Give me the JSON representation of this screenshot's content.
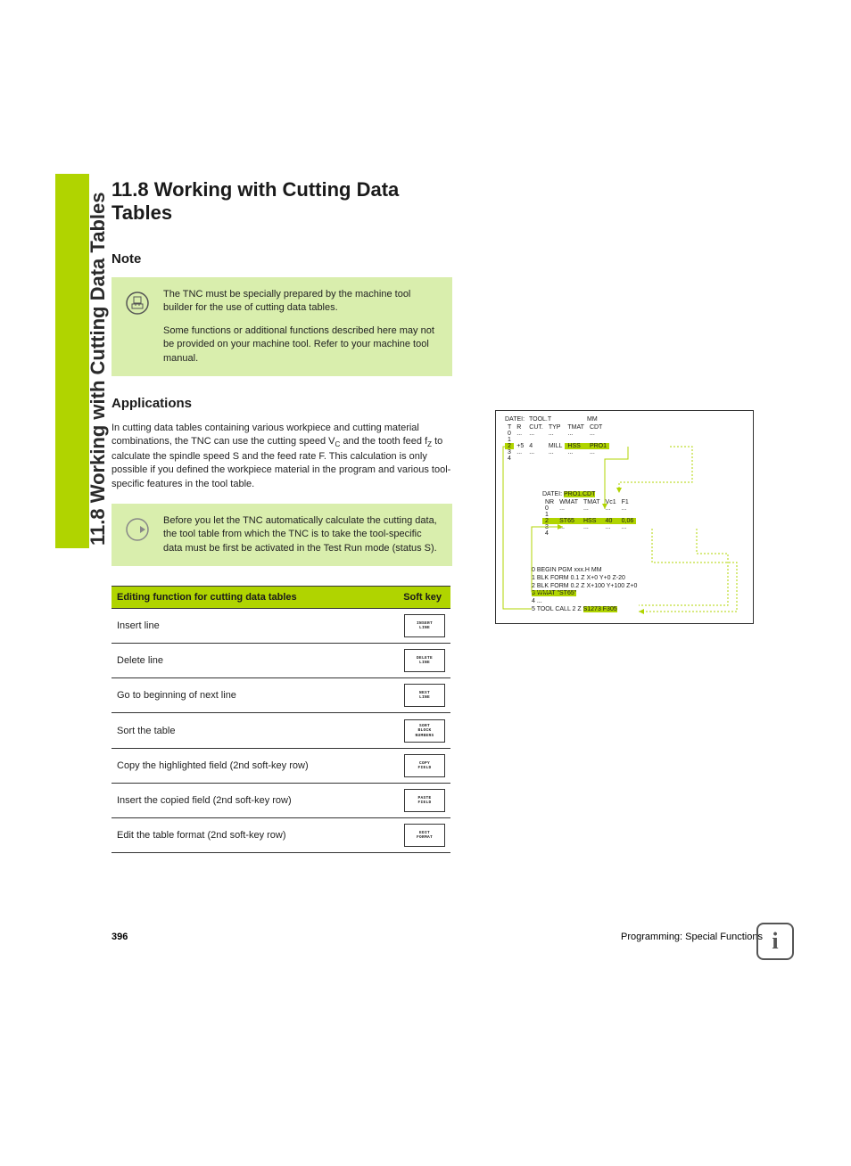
{
  "sideTab": "11.8 Working with Cutting Data Tables",
  "heading": "11.8 Working with Cutting Data Tables",
  "noteHeading": "Note",
  "note": {
    "p1": "The TNC must be specially prepared by the machine tool builder for the use of cutting data tables.",
    "p2": "Some functions or additional functions described here may not be provided on your machine tool. Refer to your machine tool manual."
  },
  "appsHeading": "Applications",
  "apps": {
    "body": "In cutting data tables containing various workpiece and cutting material combinations, the TNC can use the cutting speed V<sub>C</sub> and the tooth feed f<sub>Z</sub> to calculate the spindle speed S and the feed rate F. This calculation is only possible if you defined the workpiece material in the program and various tool-specific features in the tool table.",
    "tip": "Before you let the TNC automatically calculate the cutting data, the tool table from which the TNC is to take the tool-specific data must be first be activated in the Test Run mode (status S)."
  },
  "tableHeader": {
    "func": "Editing function for cutting data tables",
    "key": "Soft key"
  },
  "rows": [
    {
      "func": "Insert line",
      "key": [
        "INSERT",
        "LINE"
      ]
    },
    {
      "func": "Delete line",
      "key": [
        "DELETE",
        "LINE"
      ]
    },
    {
      "func": "Go to beginning of next line",
      "key": [
        "NEXT",
        "LINE"
      ]
    },
    {
      "func": "Sort the table",
      "key": [
        "SORT",
        "BLOCK",
        "NUMBERS"
      ]
    },
    {
      "func": "Copy the highlighted field (2nd soft-key row)",
      "key": [
        "COPY",
        "FIELD"
      ]
    },
    {
      "func": "Insert the copied field (2nd soft-key row)",
      "key": [
        "PASTE",
        "FIELD"
      ]
    },
    {
      "func": "Edit the table format (2nd soft-key row)",
      "key": [
        "EDIT",
        "FORMAT"
      ]
    }
  ],
  "diag": {
    "t1": {
      "title": [
        "DATEI:",
        "TOOL.T",
        "MM"
      ],
      "head": [
        "T",
        "R",
        "CUT.",
        "TYP",
        "TMAT",
        "CDT"
      ],
      "r0": [
        "0",
        "...",
        "...",
        "...",
        "...",
        "..."
      ],
      "r1": [
        "1",
        " ",
        " ",
        " ",
        " ",
        " "
      ],
      "r2": [
        "2",
        "+5",
        "4",
        "MILL",
        "HSS",
        "PRO1"
      ],
      "r3": [
        "3",
        "...",
        "...",
        "...",
        "...",
        "..."
      ],
      "r4": [
        "4",
        " ",
        " ",
        " ",
        " ",
        " "
      ]
    },
    "t2": {
      "title": [
        "DATEI:",
        "PRO1.CDT"
      ],
      "head": [
        "NR",
        "WMAT",
        "TMAT",
        "Vc1",
        "F1"
      ],
      "r0": [
        "0",
        "...",
        "...",
        "...",
        "..."
      ],
      "r1": [
        "1",
        " ",
        " ",
        " ",
        " "
      ],
      "r2": [
        "2",
        "ST65",
        "HSS",
        "40",
        "0,06"
      ],
      "r3": [
        "3",
        "...",
        "...",
        "...",
        "..."
      ],
      "r4": [
        "4",
        " ",
        " ",
        " ",
        " "
      ]
    },
    "code": {
      "l0": "0 BEGIN PGM xxx.H MM",
      "l1": "1 BLK FORM 0.1 Z X+0 Y+0 Z-20",
      "l2": "2 BLK FORM 0.2 Z X+100 Y+100 Z+0",
      "l3a": "3 WMAT \"ST65\"",
      "l4": "4 ...",
      "l5a": "5 TOOL CALL 2 Z ",
      "l5b": "S1273 F305"
    }
  },
  "footer": {
    "page": "396",
    "chap": "Programming: Special Functions"
  }
}
